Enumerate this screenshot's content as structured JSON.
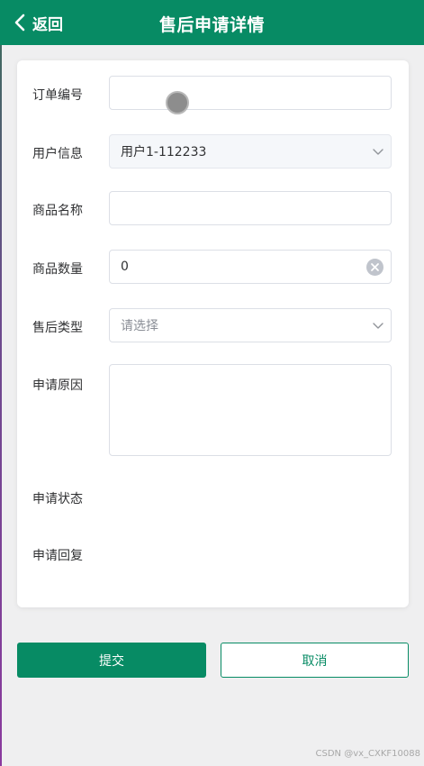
{
  "header": {
    "back_label": "返回",
    "title": "售后申请详情",
    "icons": {
      "back": "chevron-left-icon"
    }
  },
  "form": {
    "order_no": {
      "label": "订单编号",
      "value": ""
    },
    "user_info": {
      "label": "用户信息",
      "value": "用户1-112233",
      "icon": "chevron-down-icon"
    },
    "product_name": {
      "label": "商品名称",
      "value": ""
    },
    "quantity": {
      "label": "商品数量",
      "value": "0",
      "icon": "clear-circle-icon"
    },
    "aftersale_type": {
      "label": "售后类型",
      "placeholder": "请选择",
      "icon": "chevron-down-icon"
    },
    "reason": {
      "label": "申请原因",
      "value": ""
    },
    "status": {
      "label": "申请状态",
      "value": ""
    },
    "reply": {
      "label": "申请回复",
      "value": ""
    }
  },
  "buttons": {
    "submit": "提交",
    "cancel": "取消"
  },
  "watermark": "CSDN @vx_CXKF10088",
  "colors": {
    "primary": "#078b64",
    "background": "#efeff0",
    "card": "#ffffff",
    "border": "#dcdfe6"
  }
}
